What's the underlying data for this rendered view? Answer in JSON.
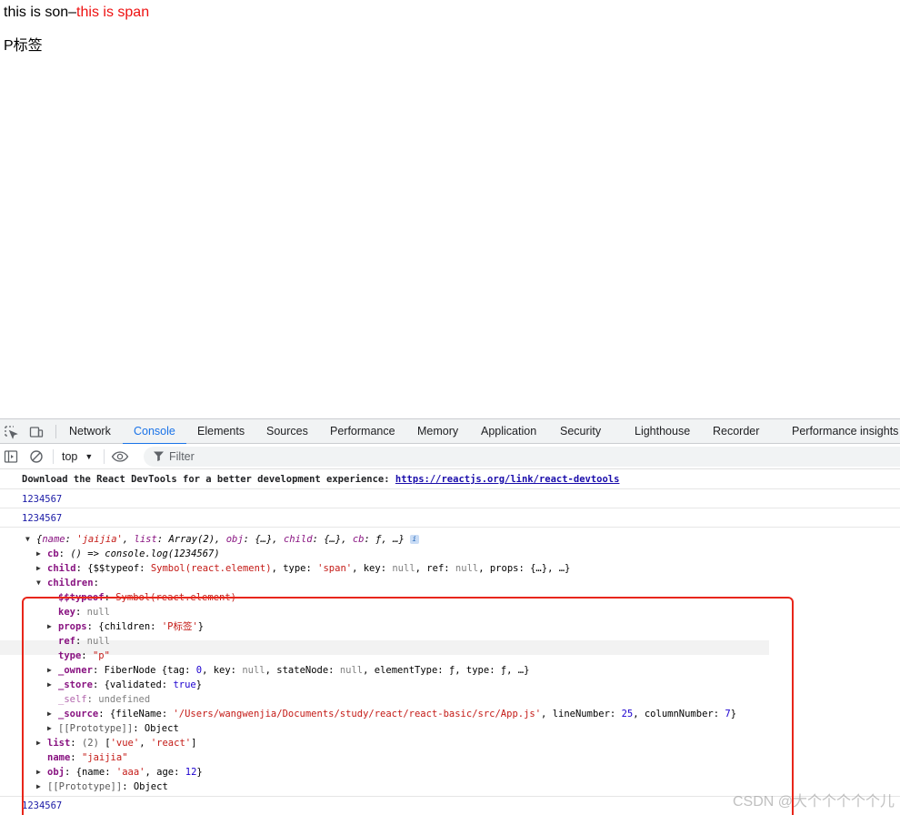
{
  "page": {
    "son_text": "this is son–",
    "span_text": "this is span",
    "p_text": "P标签"
  },
  "devtools": {
    "tabs": [
      "Network",
      "Console",
      "Elements",
      "Sources",
      "Performance",
      "Memory",
      "Application",
      "Security",
      "Lighthouse",
      "Recorder",
      "Performance insights"
    ],
    "active_tab": "Console",
    "context": "top",
    "filter_placeholder": "Filter"
  },
  "console": {
    "react_msg": "Download the React DevTools for a better development experience: ",
    "react_link": "https://reactjs.org/link/react-devtools",
    "log1": "1234567",
    "log2": "1234567",
    "log_end": "1234567",
    "obj_preview": {
      "open": "{",
      "name_key": "name",
      "name_val": "'jaijia'",
      "list_key": "list",
      "list_val": "Array(2)",
      "obj_key": "obj",
      "obj_val": "{…}",
      "child_key": "child",
      "child_val": "{…}",
      "cb_key": "cb",
      "cb_val": "ƒ",
      "close": ", …}"
    },
    "tree": {
      "cb_key": "cb",
      "cb_val": "() => console.log(1234567)",
      "child_key": "child",
      "child_pre": "{$$typeof: ",
      "child_sym": "Symbol(react.element)",
      "child_type_key": ", type: ",
      "child_type_val": "'span'",
      "child_key_key": ", key: ",
      "child_key_val": "null",
      "child_ref_key": ", ref: ",
      "child_ref_val": "null",
      "child_rest": ", props: {…}, …}",
      "children_key": "children",
      "typeof_key": "$$typeof",
      "typeof_val": "Symbol(react.element)",
      "key_key": "key",
      "key_val": "null",
      "props_key": "props",
      "props_pre": "{children: ",
      "props_val": "'P标签'",
      "props_post": "}",
      "ref_key": "ref",
      "ref_val": "null",
      "type_key": "type",
      "type_val": "\"p\"",
      "owner_key": "_owner",
      "owner_pre": "FiberNode {tag: ",
      "owner_tag": "0",
      "owner_key2": ", key: ",
      "owner_keyval": "null",
      "owner_sn": ", stateNode: ",
      "owner_snval": "null",
      "owner_rest": ", elementType: ƒ, type: ƒ, …}",
      "store_key": "_store",
      "store_pre": "{validated: ",
      "store_val": "true",
      "store_post": "}",
      "self_key": "_self",
      "self_val": "undefined",
      "source_key": "_source",
      "source_pre": "{fileName: ",
      "source_file": "'/Users/wangwenjia/Documents/study/react/react-basic/src/App.js'",
      "source_ln": ", lineNumber: ",
      "source_ln_val": "25",
      "source_cn": ", columnNumber: ",
      "source_cn_val": "7",
      "source_post": "}",
      "proto_inner": "[[Prototype]]",
      "proto_inner_val": "Object",
      "list_key": "list",
      "list_count": "(2) ",
      "list_pre": "[",
      "list_v1": "'vue'",
      "list_sep": ", ",
      "list_v2": "'react'",
      "list_post": "]",
      "name_key": "name",
      "name_val": "\"jaijia\"",
      "obj_key": "obj",
      "obj_pre": "{name: ",
      "obj_name": "'aaa'",
      "obj_mid": ", age: ",
      "obj_age": "12",
      "obj_post": "}",
      "proto_outer": "[[Prototype]]",
      "proto_outer_val": "Object"
    }
  },
  "watermark": "CSDN @大个个个个个儿"
}
